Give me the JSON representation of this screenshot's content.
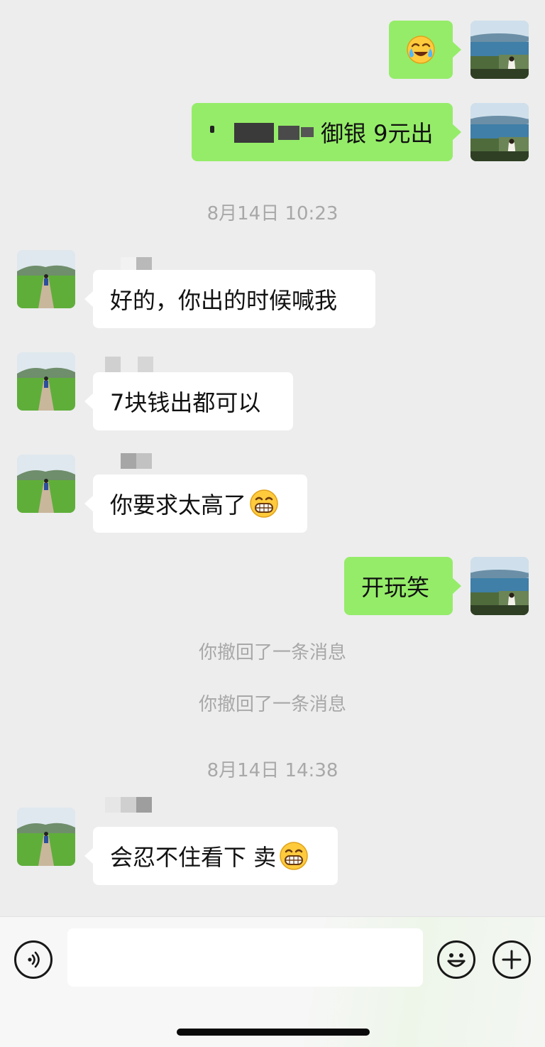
{
  "messages": [
    {
      "sender": "self",
      "type": "emoji",
      "emoji": "laughing-crying-emoji"
    },
    {
      "sender": "self",
      "text_visible": "御银 9元出",
      "prefix_redacted": true
    },
    {
      "type": "timestamp",
      "text": "8月14日 10:23"
    },
    {
      "sender": "peer",
      "text": "好的，你出的时候喊我"
    },
    {
      "sender": "peer",
      "text": "7块钱出都可以"
    },
    {
      "sender": "peer",
      "text": "你要求太高了",
      "trailing_emoji": "grinning-emoji"
    },
    {
      "sender": "self",
      "text": "开玩笑"
    },
    {
      "type": "system",
      "text": "你撤回了一条消息"
    },
    {
      "type": "system",
      "text": "你撤回了一条消息"
    },
    {
      "type": "timestamp",
      "text": "8月14日 14:38"
    },
    {
      "sender": "peer",
      "text": "会忍不住看下 卖",
      "trailing_emoji": "grinning-emoji"
    }
  ],
  "input_bar": {
    "voice_icon": "voice-toggle-icon",
    "input_value": "",
    "emoji_icon": "emoji-picker-icon",
    "plus_icon": "more-plus-icon"
  },
  "colors": {
    "background": "#ededed",
    "self_bubble": "#95ec69",
    "peer_bubble": "#ffffff",
    "system_text": "#a8a8a8"
  }
}
